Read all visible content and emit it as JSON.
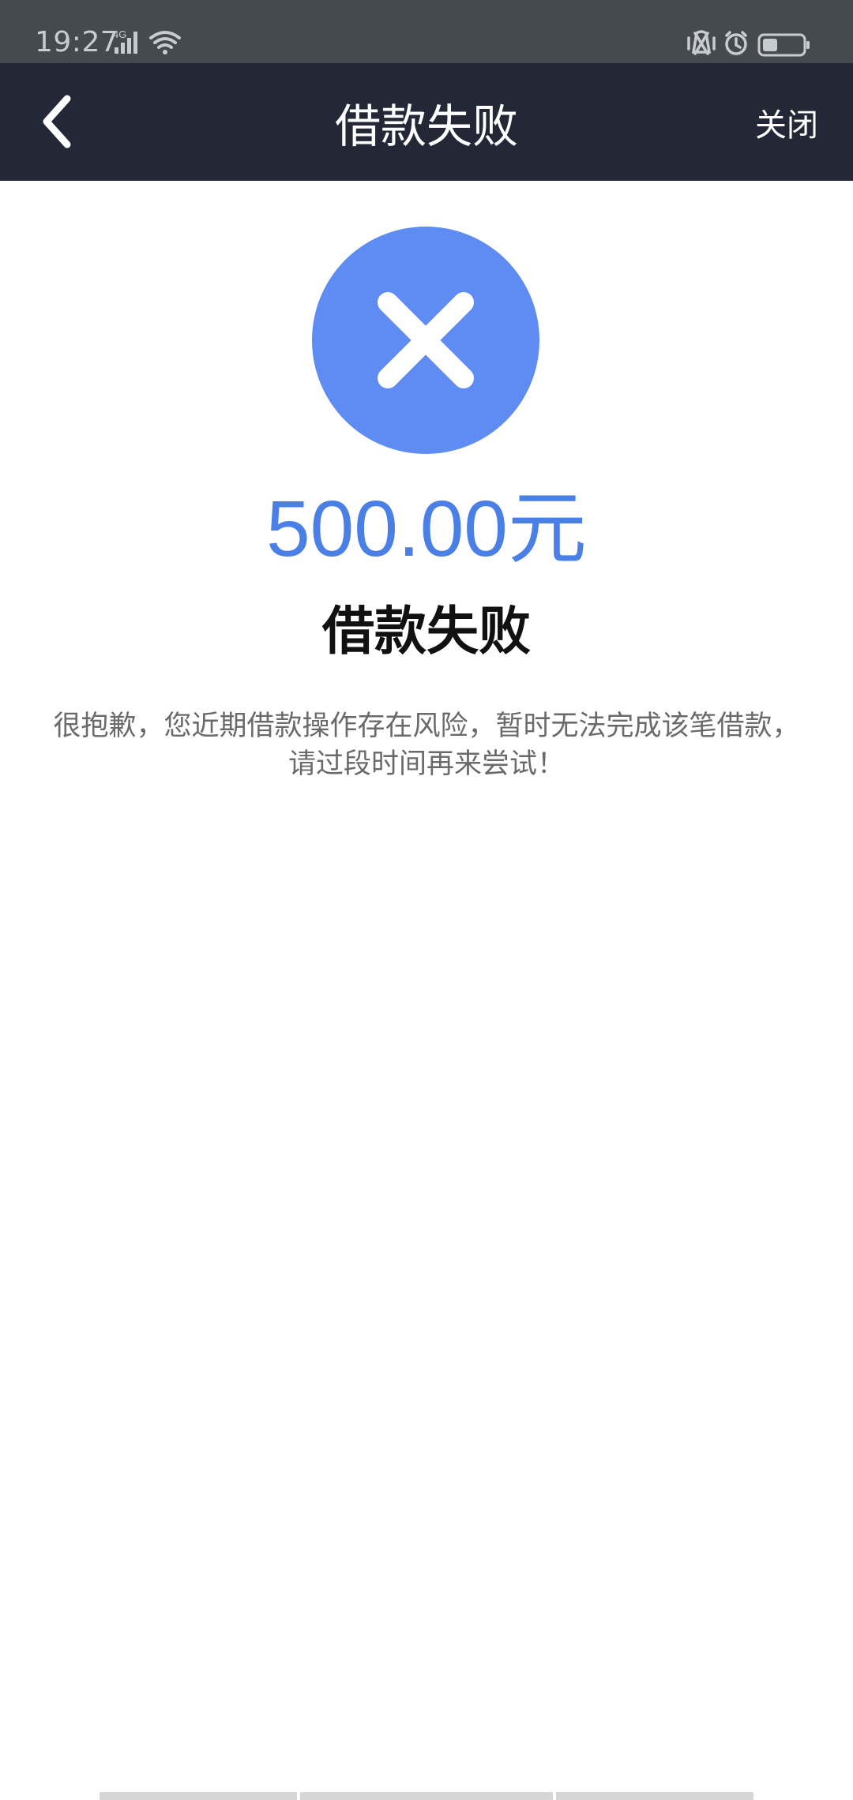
{
  "status_bar": {
    "time": "19:27",
    "network": "4G",
    "icons": [
      "signal-icon",
      "wifi-icon",
      "vibrate-icon",
      "alarm-icon",
      "battery-icon"
    ],
    "background_color": "#454a4f"
  },
  "nav": {
    "title": "借款失败",
    "close_label": "关闭",
    "back_icon": "chevron-left-icon",
    "background_color": "#232736"
  },
  "result": {
    "icon": "close-circle-icon",
    "icon_color": "#5e8cf3",
    "amount": "500.00元",
    "amount_color": "#4a7fe6",
    "title": "借款失败",
    "description_line1": "很抱歉，您近期借款操作存在风险，暂时无法完成该笔借款，",
    "description_line2": "请过段时间再来尝试！"
  }
}
